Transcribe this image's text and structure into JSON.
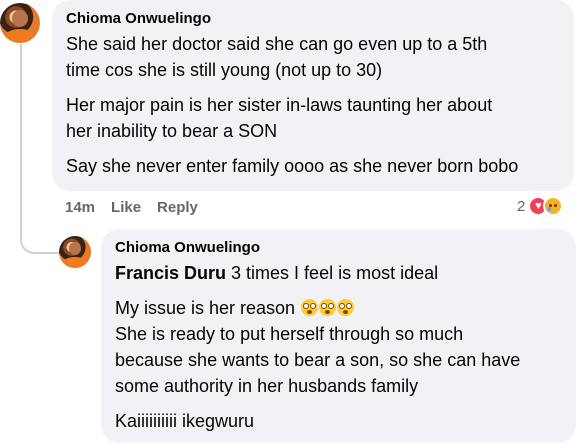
{
  "comment": {
    "author": "Chioma Onwuelingo",
    "paragraphs": [
      [
        "She said her doctor said she can go even up to a 5th",
        "time cos she is still young (not up to 30)"
      ],
      [
        "Her major pain is her sister in-laws taunting her about",
        "her inability to bear a SON"
      ],
      [
        "Say she never enter family oooo as she never born bobo"
      ]
    ],
    "time": "14m",
    "like_label": "Like",
    "reply_label": "Reply",
    "reaction_count": "2",
    "reaction_icons": [
      "heart-icon",
      "sad-icon"
    ]
  },
  "reply": {
    "author": "Chioma Onwuelingo",
    "mention": "Francis Duru",
    "mention_text": " 3 times I feel is most ideal",
    "line_issue": "My issue is her reason ",
    "emoji_count": 3,
    "emoji_name": "flushed-face-icon",
    "para2": [
      "She is ready to put herself through so much",
      "because she wants to bear a son, so she can have",
      "some authority in her husbands family"
    ],
    "last": "Kaiiiiiiiiii ikegwuru"
  },
  "colors": {
    "bubble": "#f0f2f5",
    "meta": "#65676b",
    "heart": "#f33e58",
    "sad": "#f7b125"
  }
}
